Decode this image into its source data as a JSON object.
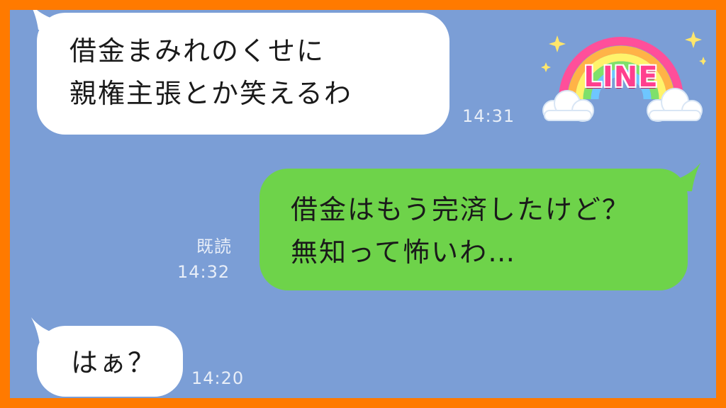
{
  "logo": {
    "text": "LINE",
    "icon": "line-rainbow-logo"
  },
  "colors": {
    "border": "#ff7a00",
    "chat_background": "#7b9ed6",
    "incoming_bubble": "#ffffff",
    "outgoing_bubble": "#6ed34a",
    "timestamp": "#e8eef8"
  },
  "messages": [
    {
      "direction": "incoming",
      "lines": [
        "借金まみれのくせに",
        "親権主張とか笑えるわ"
      ],
      "time": "14:31"
    },
    {
      "direction": "outgoing",
      "lines": [
        "借金はもう完済したけど？",
        "無知って怖いわ…"
      ],
      "read_label": "既読",
      "time": "14:32"
    },
    {
      "direction": "incoming",
      "lines": [
        "はぁ？"
      ],
      "time": "14:20"
    }
  ]
}
